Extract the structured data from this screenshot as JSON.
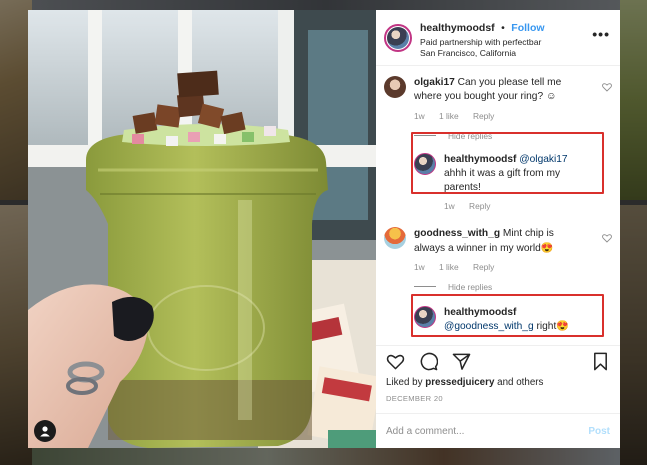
{
  "post": {
    "username": "healthymoodsf",
    "separator": "•",
    "follow_label": "Follow",
    "sponsor_line": "Paid partnership with perfectbar",
    "location": "San Francisco, California",
    "more_label": "•••"
  },
  "comments": [
    {
      "username": "olgaki17",
      "text": "Can you please tell me where you bought your ring? ☺",
      "age": "1w",
      "likes": "1 like",
      "reply_label": "Reply",
      "hide_replies_label": "Hide replies",
      "reply": {
        "username": "healthymoodsf",
        "mention": "@olgaki17",
        "text": "ahhh it was a gift from my parents!",
        "age": "1w",
        "reply_label": "Reply"
      }
    },
    {
      "username": "goodness_with_g",
      "text": "Mint chip is always a winner in my world😍",
      "age": "1w",
      "likes": "1 like",
      "reply_label": "Reply",
      "hide_replies_label": "Hide replies",
      "reply": {
        "username": "healthymoodsf",
        "mention": "@goodness_with_g",
        "text": "right😍"
      }
    }
  ],
  "likes": {
    "prefix": "Liked by",
    "user": "pressedjuicery",
    "suffix": "and others"
  },
  "date": "DECEMBER 20",
  "add_comment": {
    "placeholder": "Add a comment...",
    "post_label": "Post"
  },
  "colors": {
    "link": "#3897f0",
    "highlight": "#d9302c",
    "muted": "#8e8e8e"
  }
}
